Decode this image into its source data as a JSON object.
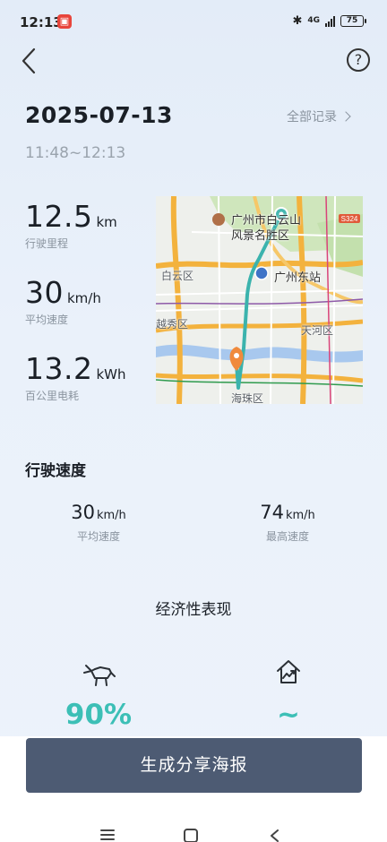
{
  "status_bar": {
    "time": "12:13",
    "app_badge_icon": "app-notification-icon",
    "bluetooth_icon": "bluetooth-icon",
    "network": "4G",
    "battery": "75"
  },
  "header": {
    "back_icon": "chevron-left-icon",
    "help_label": "?"
  },
  "trip": {
    "date": "2025-07-13",
    "all_records": "全部记录",
    "time_range": "11:48~12:13"
  },
  "stats": {
    "distance": {
      "value": "12.5",
      "unit": "km",
      "label": "行驶里程"
    },
    "avg_speed": {
      "value": "30",
      "unit": "km/h",
      "label": "平均速度"
    },
    "energy": {
      "value": "13.2",
      "unit": "kWh",
      "label": "百公里电耗"
    }
  },
  "map": {
    "labels": {
      "scenic": "广州市白云山",
      "scenic2": "风景名胜区",
      "station": "广州东站",
      "baiyun": "白云区",
      "yuexiu": "越秀区",
      "tianhe": "天河区",
      "haizhu": "海珠区",
      "road": "S324"
    },
    "colors": {
      "route": "#3bb3ad",
      "major_road": "#f3b23d",
      "river": "#a8c8ee",
      "park": "#c9e3b4",
      "start_marker": "#46b7b1",
      "end_marker": "#f08a3c"
    }
  },
  "speed": {
    "title": "行驶速度",
    "avg": {
      "value": "30",
      "unit": "km/h",
      "label": "平均速度"
    },
    "max": {
      "value": "74",
      "unit": "km/h",
      "label": "最高速度"
    }
  },
  "economy": {
    "title": "经济性表现",
    "left_icon": "ox-icon",
    "left_value": "90%",
    "right_icon": "house-trend-icon",
    "right_value": "~",
    "accent": "#3cbfb6"
  },
  "share_button": {
    "label": "生成分享海报",
    "color": "#4d5b73"
  },
  "nav": {
    "menu_icon": "menu-icon",
    "home_icon": "home-icon",
    "back_icon": "back-icon"
  }
}
